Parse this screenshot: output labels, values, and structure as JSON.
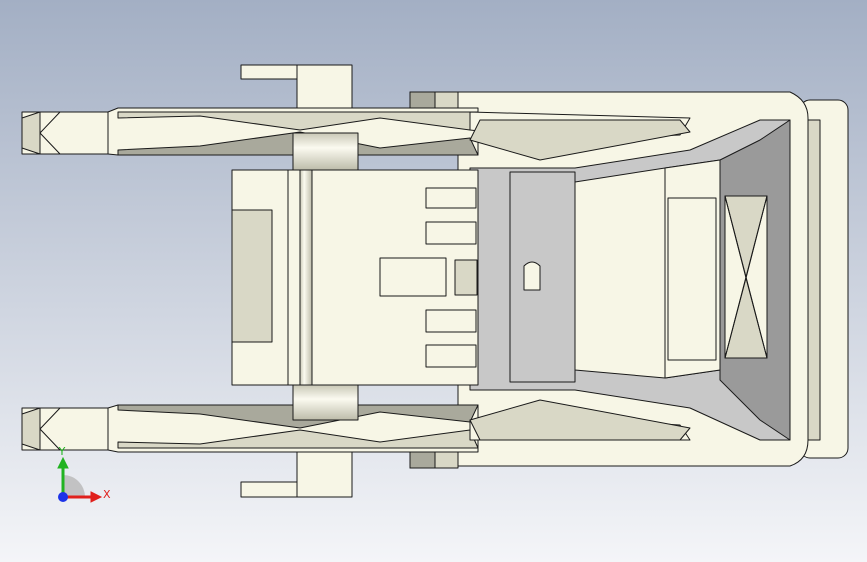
{
  "viewport": {
    "background_top": "#a3afc4",
    "background_bottom": "#f4f5f8"
  },
  "model": {
    "part_fill": "#f7f6e6",
    "part_shade": "#d9d8c6",
    "part_dark": "#a9a99c",
    "edge_color": "#1a1a1a",
    "grey_fill": "#c8c8c8",
    "grey_dark": "#9a9a9a"
  },
  "triad": {
    "x_label": "X",
    "y_label": "Y",
    "x_color": "#e0201c",
    "y_color": "#21b321",
    "z_color": "#1c33e8"
  }
}
